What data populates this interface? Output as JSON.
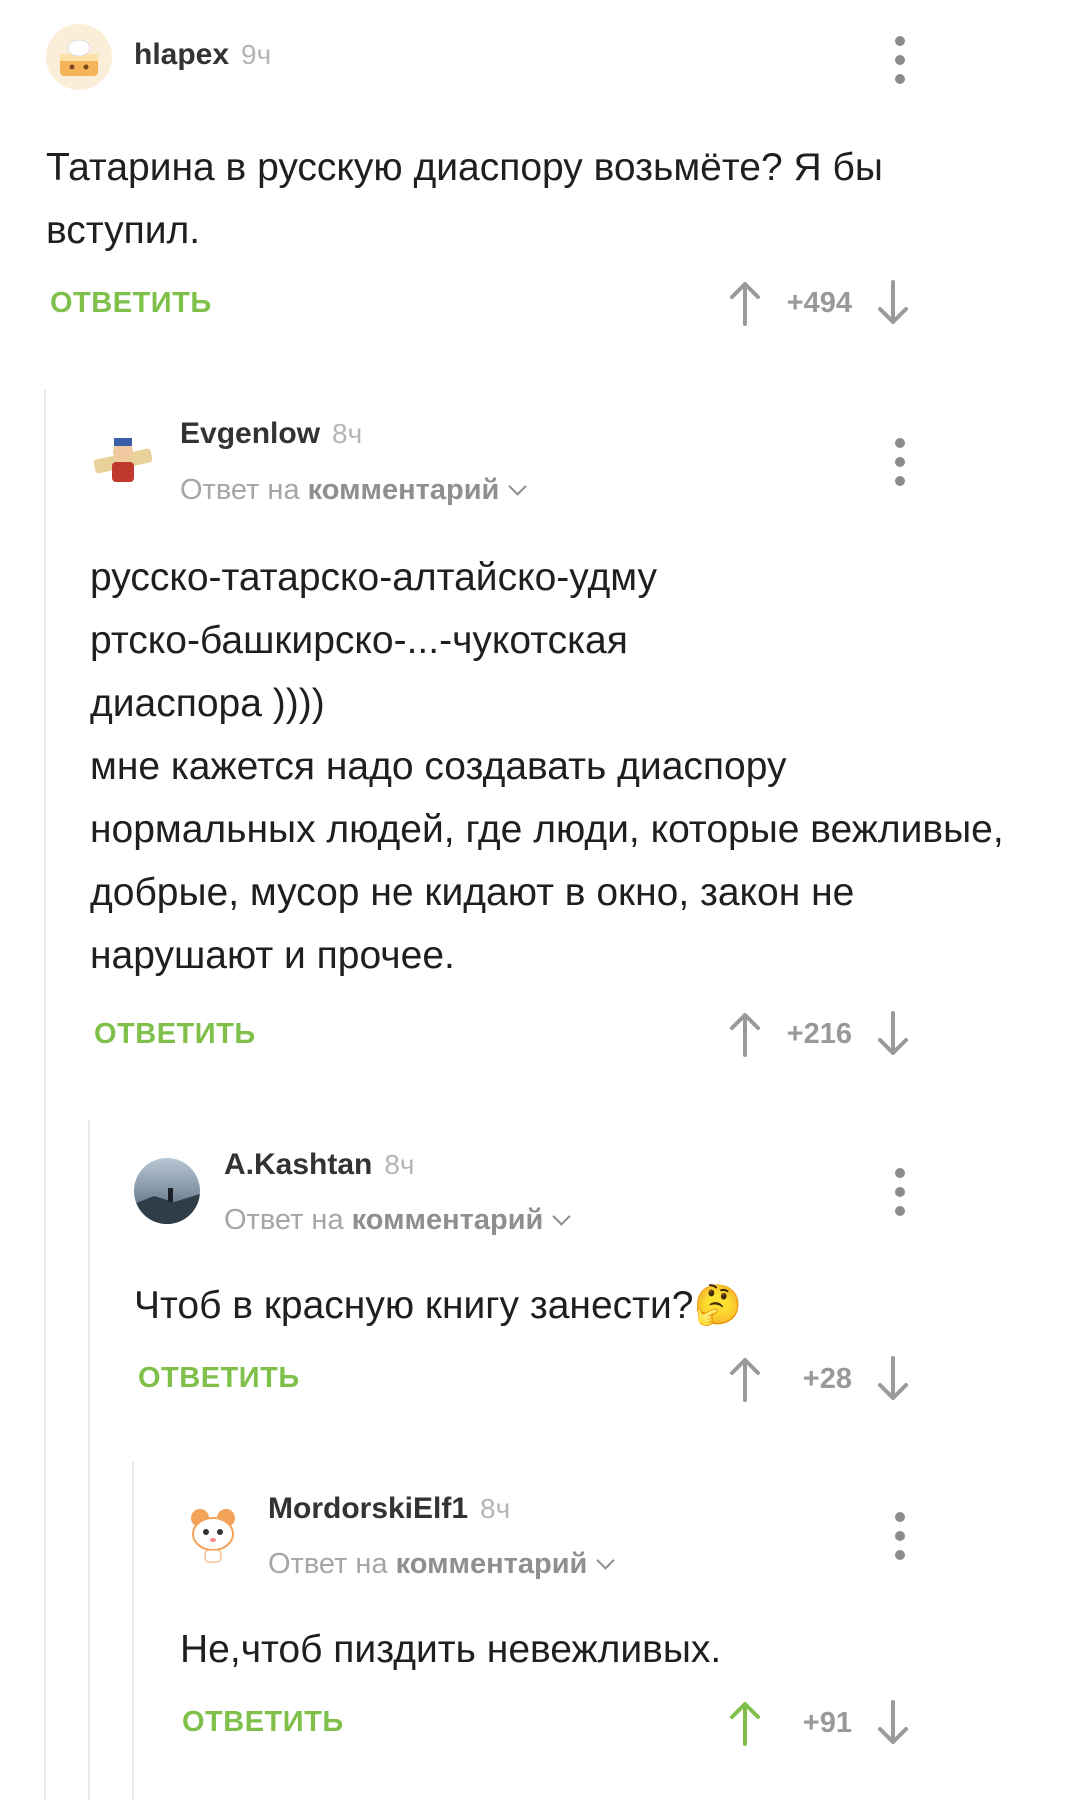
{
  "colors": {
    "accent": "#7fc04b",
    "muted": "#a6a6a6",
    "text": "#1f1f1f",
    "upvoted": "#7fc04b"
  },
  "comments": [
    {
      "author": "hlapex",
      "time": "9ч",
      "text": "Татарина в русскую диаспору возьмёте? Я бы вступил.",
      "reply_label": "ОТВЕТИТЬ",
      "score": "+494",
      "avatar_icon": "cake-avatar-icon"
    },
    {
      "author": "Evgenlow",
      "time": "8ч",
      "reply_to_prefix": "Ответ на",
      "reply_to_link": "комментарий",
      "text": "русско-татарско-алтайско-удму\nртско-башкирско-...-чукотская\nдиаспора ))))\nмне кажется надо создавать диаспору нормальных людей, где люди, которые вежливые, добрые, мусор не кидают в окно, закон не нарушают и прочее.",
      "reply_label": "ОТВЕТИТЬ",
      "score": "+216",
      "avatar_icon": "cartoon-avatar-icon"
    },
    {
      "author": "A.Kashtan",
      "time": "8ч",
      "reply_to_prefix": "Ответ на",
      "reply_to_link": "комментарий",
      "text": "Чтоб в красную книгу занести?🤔",
      "reply_label": "ОТВЕТИТЬ",
      "score": "+28",
      "avatar_icon": "landscape-avatar-icon"
    },
    {
      "author": "MordorskiElf1",
      "time": "8ч",
      "reply_to_prefix": "Ответ на",
      "reply_to_link": "комментарий",
      "text": "Не,чтоб пиздить невежливых.",
      "reply_label": "ОТВЕТИТЬ",
      "score": "+91",
      "avatar_icon": "hamster-avatar-icon"
    }
  ]
}
